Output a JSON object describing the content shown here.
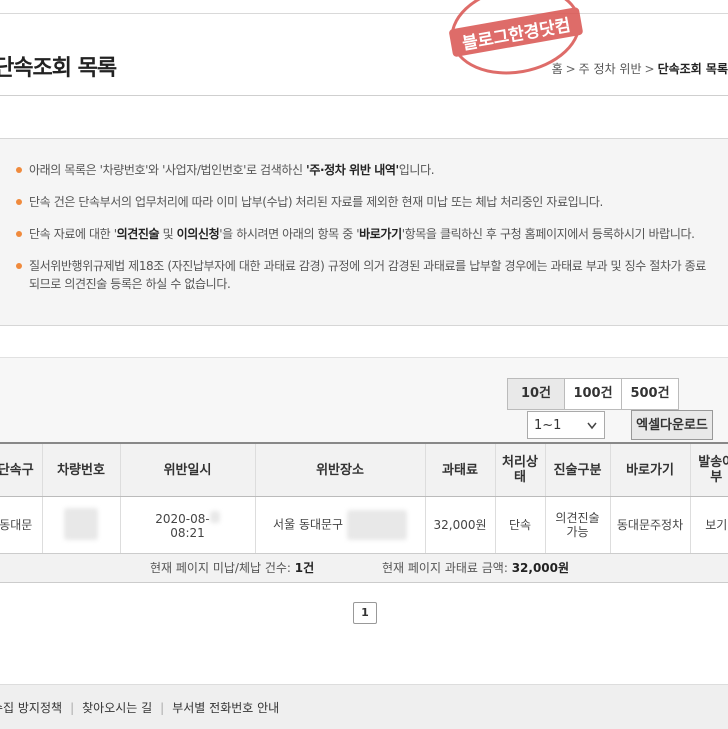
{
  "header": {
    "title": "단속조회 목록",
    "breadcrumb": {
      "home": "홈",
      "section": "주 정차 위반",
      "current": "단속조회 목록"
    }
  },
  "notices": [
    {
      "pre": "아래의 목록은 '차량번호'와 '사업자/법인번호'로 검색하신 ",
      "strong": "'주·정차 위반 내역'",
      "post": "입니다."
    },
    {
      "text": "단속 건은 단속부서의 업무처리에 따라 이미 납부(수납) 처리된 자료를 제외한 현재 미납 또는 체납 처리중인 자료입니다."
    },
    {
      "pre": "단속 자료에 대한 '",
      "s1": "의견진술",
      "m1": " 및 ",
      "s2": "이의신청",
      "m2": "'을 하시려면 아래의 항목 중 '",
      "s3": "바로가기",
      "post": "'항목을 클릭하신 후 구청 홈페이지에서 등록하시기 바랍니다."
    },
    {
      "text": "질서위반행위규제법 제18조 (자진납부자에 대한 과태료 감경) 규정에 의거 감경된 과태료를 납부할 경우에는 과태료 부과 및 징수 절차가 종료되므로 의견진술 등록은 하실 수 없습니다."
    }
  ],
  "list_controls": {
    "page_sizes": [
      "10건",
      "100건",
      "500건"
    ],
    "active_page_size": "10건",
    "range_select": "1~1",
    "excel_button": "엑셀다운로드"
  },
  "table": {
    "columns": [
      "단속구",
      "차량번호",
      "위반일시",
      "위반장소",
      "과태료",
      "처리상태",
      "진술구분",
      "바로가기",
      "발송여부"
    ],
    "rows": [
      {
        "district": "동대문",
        "plate": "",
        "datetime_date": "2020-08-",
        "datetime_time": "08:21",
        "location": "서울 동대문구",
        "fine": "32,000원",
        "status": "단속",
        "statement": "의견진술 가능",
        "shortcut": "동대문주정차",
        "sent": "보기"
      }
    ]
  },
  "summary": {
    "count_label": "현재 페이지 미납/체납 건수: ",
    "count_value": "1건",
    "amount_label": "현재 페이지 과태료 금액: ",
    "amount_value": "32,000원"
  },
  "pagination": {
    "current": "1"
  },
  "footer": {
    "links": [
      "수집 방지정책",
      "찾아오시는 길",
      "부서별 전화번호 안내"
    ]
  },
  "watermark": {
    "text": "블로그한경닷컴",
    "color": "#d9534f"
  },
  "colors": {
    "bullet": "#f08a3c",
    "stamp": "#d9534f"
  }
}
